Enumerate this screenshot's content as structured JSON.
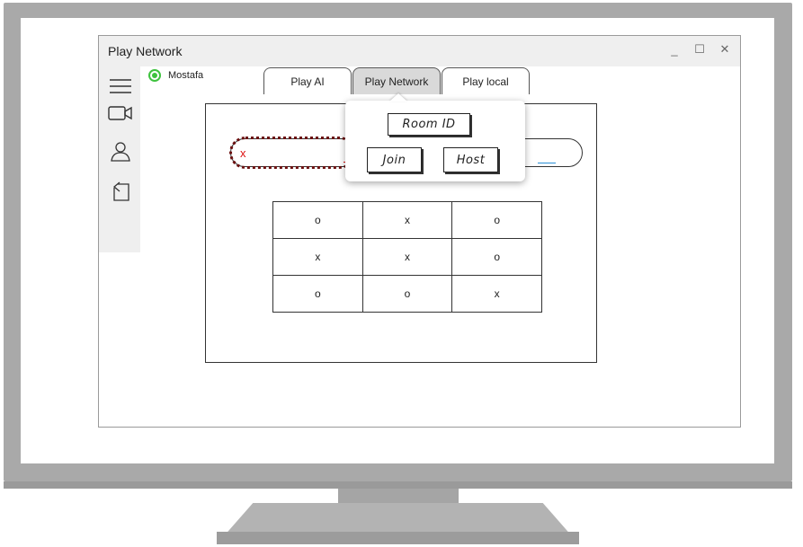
{
  "window": {
    "title": "Play Network",
    "controls": {
      "minimize": "_",
      "maximize": "☐",
      "close": "✕"
    }
  },
  "sidebar": {
    "items": [
      {
        "icon": "menu-icon"
      },
      {
        "icon": "video-camera-icon"
      },
      {
        "icon": "user-icon"
      },
      {
        "icon": "exit-icon"
      }
    ]
  },
  "user": {
    "name": "Mostafa",
    "status_color": "#3ec23e"
  },
  "tabs": [
    {
      "label": "Play AI"
    },
    {
      "label": "Play Network",
      "active": true
    },
    {
      "label": "Play local"
    }
  ],
  "scoreboard": {
    "player_mark": "x",
    "player_color": "#d11111",
    "opponent_color": "#2a8fd6"
  },
  "board": {
    "rows": [
      [
        "o",
        "x",
        "o"
      ],
      [
        "x",
        "x",
        "o"
      ],
      [
        "o",
        "o",
        "x"
      ]
    ]
  },
  "popup": {
    "room_id_label": "Room ID",
    "join_label": "Join",
    "host_label": "Host"
  }
}
